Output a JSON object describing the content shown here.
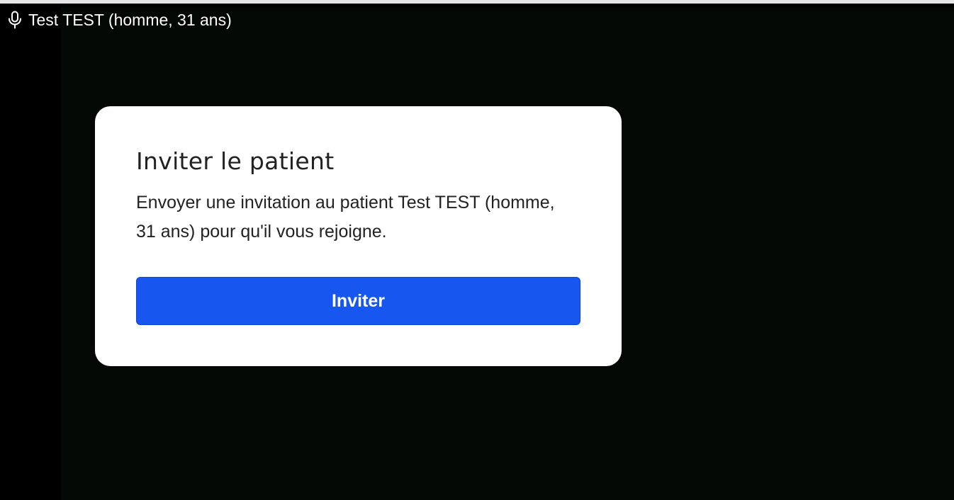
{
  "participant": {
    "icon": "microphone-icon",
    "label": "Test TEST (homme, 31 ans)"
  },
  "modal": {
    "title": "Inviter le patient",
    "description": "Envoyer une invitation au patient Test TEST (homme, 31 ans) pour qu'il vous rejoigne.",
    "button_label": "Inviter"
  },
  "colors": {
    "background": "#000000",
    "modal_background": "#ffffff",
    "button": "#1856f0",
    "button_text": "#ffffff",
    "text": "#222222"
  }
}
